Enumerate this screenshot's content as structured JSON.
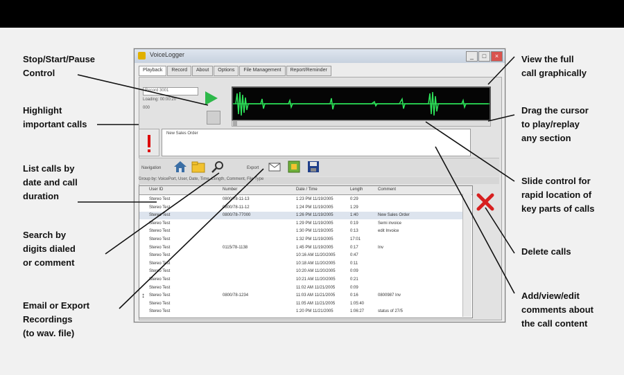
{
  "callouts": {
    "stop_start": "Stop/Start/Pause\nControl",
    "highlight": "Highlight\nimportant calls",
    "list": "List calls by\ndate and call\nduration",
    "search": "Search by\ndigits dialed\nor comment",
    "email": "Email or Export\nRecordings\n(to wav. file)",
    "view_full": "View the full\ncall graphically",
    "drag": "Drag the cursor\nto play/replay\nany section",
    "slide": "Slide control for\nrapid location of\nkey parts of calls",
    "delete": "Delete calls",
    "add": "Add/view/edit\ncomments about\nthe call content"
  },
  "window": {
    "title": "VoiceLogger",
    "tabs": [
      "Playback",
      "Record",
      "About",
      "Options",
      "File Management",
      "Report/Reminder"
    ]
  },
  "playback": {
    "field1": "Record 3001",
    "field2": "Loading: 00:00:20",
    "field3": "000",
    "comment_text": "New Sales Order"
  },
  "toolbar": {
    "navigation_label": "Navigation",
    "export_label": "Export"
  },
  "group_bar": "Group by: VoicePort, User, Date, Time, Length, Comment, File Type",
  "table": {
    "headers": [
      "User ID",
      "Number",
      "Date / Time",
      "Length",
      "Comment"
    ],
    "rows": [
      [
        "Stereo Test",
        "0800/78-11-13",
        "1:23 PM 11/19/2005",
        "0:29",
        ""
      ],
      [
        "Stereo Test",
        "0800/78-11-12",
        "1:24 PM 11/19/2005",
        "1:29",
        ""
      ],
      [
        "Stereo Test",
        "0800/78-77000",
        "1:26 PM 11/19/2005",
        "1:40",
        "New Sales Order"
      ],
      [
        "Stereo Test",
        "",
        "1:29 PM 11/19/2005",
        "0:19",
        "Semi invoice"
      ],
      [
        "Stereo Test",
        "",
        "1:30 PM 11/19/2005",
        "0:13",
        "edit Invoice"
      ],
      [
        "Stereo Test",
        "",
        "1:32 PM 11/19/2005",
        "17:01",
        ""
      ],
      [
        "Stereo Test",
        "0115/78-1138",
        "1:45 PM 11/19/2005",
        "0:17",
        "Inv"
      ],
      [
        "Stereo Test",
        "",
        "10:16 AM 11/20/2005",
        "0:47",
        ""
      ],
      [
        "Stereo Test",
        "",
        "10:18 AM 11/20/2005",
        "0:11",
        ""
      ],
      [
        "Stereo Test",
        "",
        "10:20 AM 11/20/2005",
        "0:09",
        ""
      ],
      [
        "Stereo Test",
        "",
        "10:21 AM 11/20/2005",
        "0:21",
        ""
      ],
      [
        "Stereo Test",
        "",
        "11:02 AM 11/21/2005",
        "0:09",
        ""
      ],
      [
        "Stereo Test",
        "0800/78-1234",
        "11:03 AM 11/21/2005",
        "0:16",
        "0800987 Inv"
      ],
      [
        "Stereo Test",
        "",
        "11:05 AM 11/21/2005",
        "1:05:40",
        ""
      ],
      [
        "Stereo Test",
        "",
        "1:20 PM 11/21/2005",
        "1:06:27",
        "status of 27/5"
      ]
    ]
  }
}
